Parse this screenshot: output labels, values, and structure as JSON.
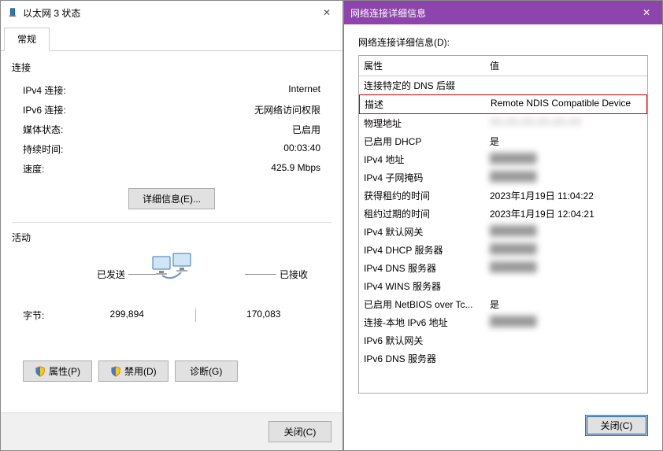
{
  "left": {
    "title": "以太网 3 状态",
    "close_x": "✕",
    "tab_general": "常规",
    "conn_header": "连接",
    "rows": {
      "ipv4_conn_k": "IPv4 连接:",
      "ipv4_conn_v": "Internet",
      "ipv6_conn_k": "IPv6 连接:",
      "ipv6_conn_v": "无网络访问权限",
      "media_k": "媒体状态:",
      "media_v": "已启用",
      "duration_k": "持续时间:",
      "duration_v": "00:03:40",
      "speed_k": "速度:",
      "speed_v": "425.9 Mbps"
    },
    "details_btn": "详细信息(E)...",
    "activity_header": "活动",
    "sent_label": "已发送",
    "recv_label": "已接收",
    "bytes_label": "字节:",
    "bytes_sent": "299,894",
    "bytes_recv": "170,083",
    "props_btn": "属性(P)",
    "disable_btn": "禁用(D)",
    "diag_btn": "诊断(G)",
    "close_btn": "关闭(C)"
  },
  "right": {
    "title": "网络连接详细信息",
    "close_x": "✕",
    "caption": "网络连接详细信息(D):",
    "head_prop": "属性",
    "head_val": "值",
    "rows": [
      {
        "p": "连接特定的 DNS 后缀",
        "v": ""
      },
      {
        "p": "描述",
        "v": "Remote NDIS Compatible Device",
        "hl": true
      },
      {
        "p": "物理地址",
        "v": "XX-XX-XX-XX-XX-XX",
        "blur": true
      },
      {
        "p": "已启用 DHCP",
        "v": "是"
      },
      {
        "p": "IPv4 地址",
        "v": "",
        "blur": true
      },
      {
        "p": "IPv4 子网掩码",
        "v": "",
        "blur": true
      },
      {
        "p": "获得租约的时间",
        "v": "2023年1月19日 11:04:22"
      },
      {
        "p": "租约过期的时间",
        "v": "2023年1月19日 12:04:21"
      },
      {
        "p": "IPv4 默认网关",
        "v": "",
        "blur": true
      },
      {
        "p": "IPv4 DHCP 服务器",
        "v": "",
        "blur": true
      },
      {
        "p": "IPv4 DNS 服务器",
        "v": "",
        "blur": true
      },
      {
        "p": "IPv4 WINS 服务器",
        "v": ""
      },
      {
        "p": "已启用 NetBIOS over Tc...",
        "v": "是"
      },
      {
        "p": "连接-本地 IPv6 地址",
        "v": "",
        "blur": true
      },
      {
        "p": "IPv6 默认网关",
        "v": ""
      },
      {
        "p": "IPv6 DNS 服务器",
        "v": ""
      }
    ],
    "close_btn": "关闭(C)"
  }
}
